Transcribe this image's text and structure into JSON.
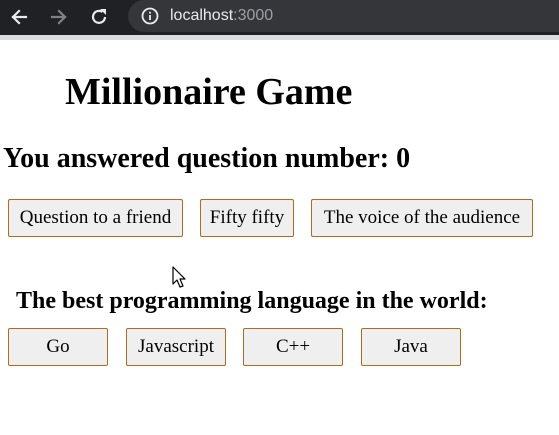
{
  "browser": {
    "url_host": "localhost",
    "url_port": ":3000",
    "icons": [
      "back-arrow",
      "forward-arrow",
      "reload",
      "info"
    ],
    "colors": {
      "toolbar": "#202124",
      "address_bar": "#35363a"
    }
  },
  "page": {
    "title": "Millionaire Game",
    "progress": "You answered question number: 0",
    "helps": [
      {
        "label": "Question to a friend"
      },
      {
        "label": "Fifty fifty"
      },
      {
        "label": "The voice of the audience"
      }
    ],
    "question": "The best programming language in the world:",
    "answers": [
      {
        "label": "Go"
      },
      {
        "label": "Javascript"
      },
      {
        "label": "C++"
      },
      {
        "label": "Java"
      }
    ],
    "colors": {
      "button_bg": "#efefef",
      "button_border": "#b26a1d"
    }
  }
}
